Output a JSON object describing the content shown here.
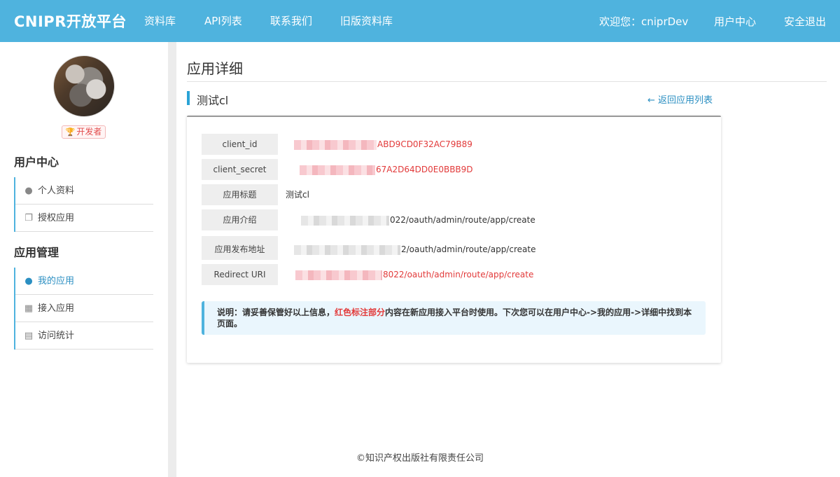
{
  "navbar": {
    "brand": "CNIPR开放平台",
    "links": [
      "资料库",
      "API列表",
      "联系我们",
      "旧版资料库"
    ],
    "welcome": "欢迎您：cniprDev",
    "user_center": "用户中心",
    "logout": "安全退出"
  },
  "sidebar": {
    "badge": "开发者",
    "sections": [
      {
        "heading": "用户中心",
        "items": [
          {
            "label": "个人资料",
            "icon": "user-icon"
          },
          {
            "label": "授权应用",
            "icon": "windows-icon"
          }
        ]
      },
      {
        "heading": "应用管理",
        "items": [
          {
            "label": "我的应用",
            "icon": "user-icon",
            "active": true
          },
          {
            "label": "接入应用",
            "icon": "building-icon"
          },
          {
            "label": "访问统计",
            "icon": "bar-chart-icon"
          }
        ]
      }
    ]
  },
  "main": {
    "page_title": "应用详细",
    "app_name": "测试cl",
    "back_link": "← 返回应用列表",
    "details": [
      {
        "label": "client_id",
        "value": "ABD9CD0F32AC79B89",
        "style": "red"
      },
      {
        "label": "client_secret",
        "value": "67A2D64DD0E0BBB9D",
        "style": "red"
      },
      {
        "label": "应用标题",
        "value": "测试cl",
        "style": "dark"
      },
      {
        "label": "应用介绍",
        "value": "022/oauth/admin/route/app/create",
        "style": "dark"
      },
      {
        "label": "应用发布地址",
        "value": "2/oauth/admin/route/app/create",
        "style": "dark"
      },
      {
        "label": "Redirect URI",
        "value": "8022/oauth/admin/route/app/create",
        "style": "red"
      }
    ],
    "notice": {
      "prefix": "说明：请妥善保管好以上信息，",
      "highlight": "红色标注部分",
      "suffix": "内容在新应用接入平台时使用。下次您可以在用户中心->我的应用->详细中找到本页面。"
    }
  },
  "footer": "©知识产权出版社有限责任公司",
  "colors": {
    "navbar": "#4fb3de",
    "accent": "#2b8fc2",
    "highlight": "#e23a3a"
  }
}
